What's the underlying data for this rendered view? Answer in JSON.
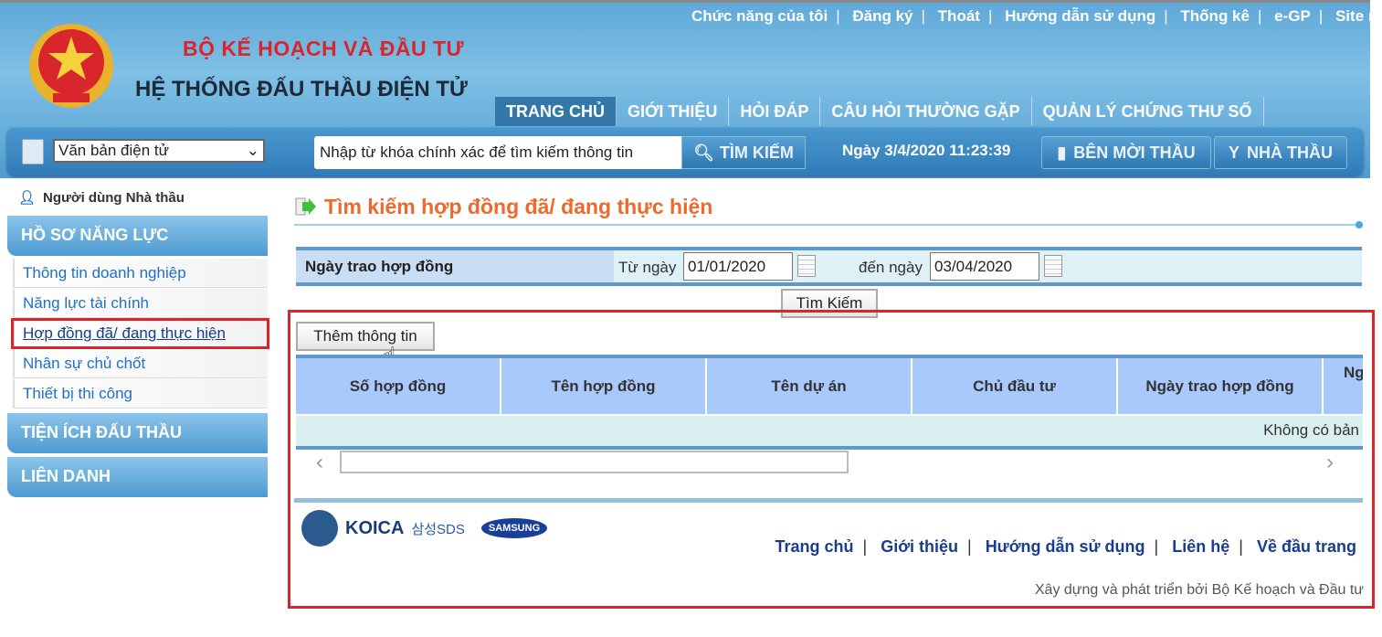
{
  "header": {
    "top_links": [
      "Chức năng của tôi",
      "Đăng ký",
      "Thoát",
      "Hướng dẫn sử dụng",
      "Thống kê",
      "e-GP",
      "Site m"
    ],
    "ministry": "BỘ KẾ HOẠCH VÀ ĐẦU TƯ",
    "system": "HỆ THỐNG ĐẤU THẦU ĐIỆN TỬ",
    "nav": [
      "TRANG CHỦ",
      "GIỚI THIỆU",
      "HỎI ĐÁP",
      "CÂU HỎI THƯỜNG GẶP",
      "QUẢN LÝ CHỨNG THƯ SỐ"
    ],
    "active_nav": "TRANG CHỦ",
    "doc_select": "Văn bản điện tử",
    "search_placeholder": "Nhập từ khóa chính xác để tìm kiếm thông tin",
    "search_button": "TÌM KIẾM",
    "datetime": "Ngày 3/4/2020 11:23:39",
    "btn_ben_moi_thau": "BÊN MỜI THẦU",
    "btn_nha_thau": "NHÀ THẦU"
  },
  "sidebar": {
    "user": "Người dùng Nhà thầu",
    "sections": [
      "HỒ SƠ NĂNG LỰC",
      "TIỆN ÍCH ĐẤU THẦU",
      "LIÊN DANH"
    ],
    "items": [
      "Thông tin doanh nghiệp",
      "Năng lực tài chính",
      "Hợp đồng đã/ đang thực hiện",
      "Nhân sự chủ chốt",
      "Thiết bị thi công"
    ],
    "current_item": "Hợp đồng đã/ đang thực hiện"
  },
  "main": {
    "title": "Tìm kiếm hợp đồng đã/ đang thực hiện",
    "filter_label": "Ngày trao hợp đồng",
    "from_label": "Từ ngày",
    "from_value": "01/01/2020",
    "to_label": "đến ngày",
    "to_value": "03/04/2020",
    "search_button": "Tìm Kiếm",
    "add_button": "Thêm thông tin",
    "columns": [
      "Số hợp đồng",
      "Tên hợp đồng",
      "Tên dự án",
      "Chủ đầu tư",
      "Ngày trao hợp đồng",
      "Ng"
    ],
    "empty_text": "Không có bản"
  },
  "footer": {
    "logos": [
      "MPI",
      "KOICA",
      "삼성SDS",
      "SAMSUNG"
    ],
    "links": [
      "Trang chủ",
      "Giới thiệu",
      "Hướng dẫn sử dụng",
      "Liên hệ",
      "Về đầu trang"
    ],
    "credit": "Xây dựng và phát triển bởi Bộ Kế hoạch và Đầu tư"
  },
  "colors": {
    "title": "#ec6a2c",
    "highlight": "#d9262c",
    "table_header": "#a9c8fc",
    "link": "#1f6fc8"
  }
}
